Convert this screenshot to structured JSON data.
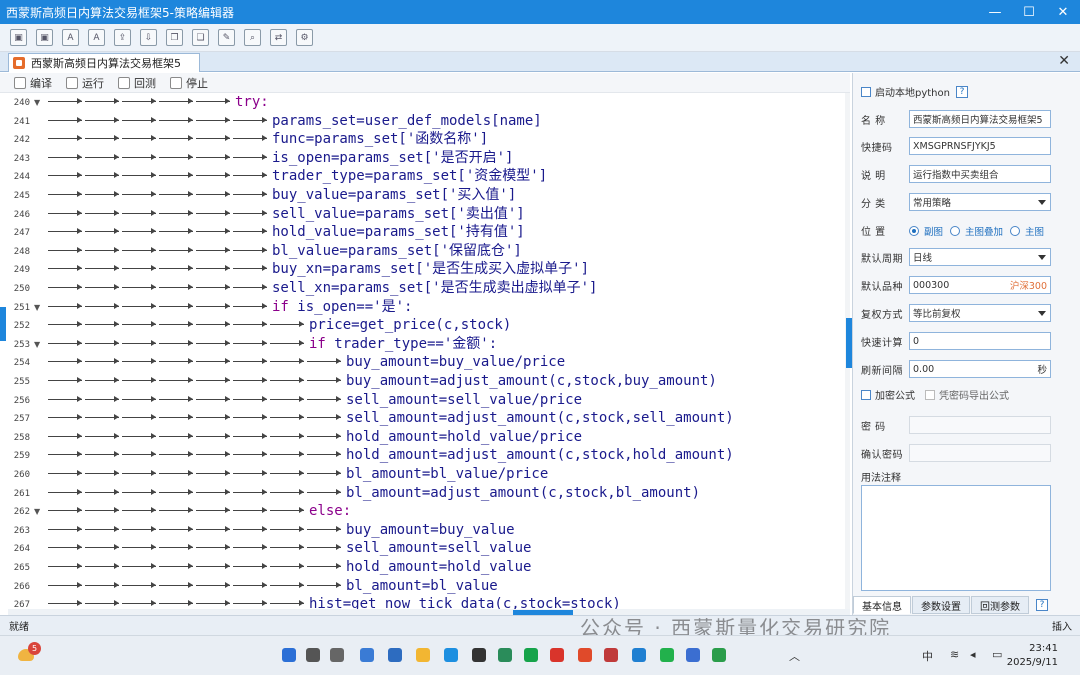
{
  "window": {
    "title": "西蒙斯高频日内算法交易框架5-策略编辑器",
    "min_label": "—",
    "max_label": "☐",
    "close_label": "✕"
  },
  "toolbar_icons": [
    "save-icon",
    "save-as-icon",
    "font-decrease-icon",
    "font-increase-icon",
    "export-icon",
    "import-icon",
    "copy-icon",
    "paste-icon",
    "edit-icon",
    "find-icon",
    "replace-icon",
    "settings-icon"
  ],
  "doc_tab": {
    "label": "西蒙斯高频日内算法交易框架5",
    "close": "✕"
  },
  "editor_toolbar": {
    "compile": "编译",
    "run": "运行",
    "backtest": "回测",
    "stop": "停止"
  },
  "code_lines": [
    {
      "n": "240",
      "fold": "▼",
      "indent": 5,
      "text": "try:",
      "kw": true
    },
    {
      "n": "241",
      "fold": "",
      "indent": 6,
      "text": "params_set=user_def_models[name]"
    },
    {
      "n": "242",
      "fold": "",
      "indent": 6,
      "text": "func=params_set['函数名称']"
    },
    {
      "n": "243",
      "fold": "",
      "indent": 6,
      "text": "is_open=params_set['是否开启']"
    },
    {
      "n": "244",
      "fold": "",
      "indent": 6,
      "text": "trader_type=params_set['资金模型']"
    },
    {
      "n": "245",
      "fold": "",
      "indent": 6,
      "text": "buy_value=params_set['买入值']"
    },
    {
      "n": "246",
      "fold": "",
      "indent": 6,
      "text": "sell_value=params_set['卖出值']"
    },
    {
      "n": "247",
      "fold": "",
      "indent": 6,
      "text": "hold_value=params_set['持有值']"
    },
    {
      "n": "248",
      "fold": "",
      "indent": 6,
      "text": "bl_value=params_set['保留底仓']"
    },
    {
      "n": "249",
      "fold": "",
      "indent": 6,
      "text": "buy_xn=params_set['是否生成买入虚拟单子']"
    },
    {
      "n": "250",
      "fold": "",
      "indent": 6,
      "text": "sell_xn=params_set['是否生成卖出虚拟单子']"
    },
    {
      "n": "251",
      "fold": "▼",
      "indent": 6,
      "text": "if is_open=='是':",
      "kwprefix": "if"
    },
    {
      "n": "252",
      "fold": "",
      "indent": 7,
      "text": "price=get_price(c,stock)"
    },
    {
      "n": "253",
      "fold": "▼",
      "indent": 7,
      "text": "if trader_type=='金额':",
      "kwprefix": "if"
    },
    {
      "n": "254",
      "fold": "",
      "indent": 8,
      "text": "buy_amount=buy_value/price"
    },
    {
      "n": "255",
      "fold": "",
      "indent": 8,
      "text": "buy_amount=adjust_amount(c,stock,buy_amount)"
    },
    {
      "n": "256",
      "fold": "",
      "indent": 8,
      "text": "sell_amount=sell_value/price"
    },
    {
      "n": "257",
      "fold": "",
      "indent": 8,
      "text": "sell_amount=adjust_amount(c,stock,sell_amount)"
    },
    {
      "n": "258",
      "fold": "",
      "indent": 8,
      "text": "hold_amount=hold_value/price"
    },
    {
      "n": "259",
      "fold": "",
      "indent": 8,
      "text": "hold_amount=adjust_amount(c,stock,hold_amount)"
    },
    {
      "n": "260",
      "fold": "",
      "indent": 8,
      "text": "bl_amount=bl_value/price"
    },
    {
      "n": "261",
      "fold": "",
      "indent": 8,
      "text": "bl_amount=adjust_amount(c,stock,bl_amount)"
    },
    {
      "n": "262",
      "fold": "▼",
      "indent": 7,
      "text": "else:",
      "kw": true
    },
    {
      "n": "263",
      "fold": "",
      "indent": 8,
      "text": "buy_amount=buy_value"
    },
    {
      "n": "264",
      "fold": "",
      "indent": 8,
      "text": "sell_amount=sell_value"
    },
    {
      "n": "265",
      "fold": "",
      "indent": 8,
      "text": "hold_amount=hold_value"
    },
    {
      "n": "266",
      "fold": "",
      "indent": 8,
      "text": "bl_amount=bl_value"
    },
    {
      "n": "267",
      "fold": "",
      "indent": 7,
      "text": "hist=get_now_tick_data(c,stock=stock)"
    }
  ],
  "panel": {
    "enable_python": "启动本地python",
    "help": "?",
    "name_label": "名    称",
    "name_value": "西蒙斯高频日内算法交易框架5",
    "shortcut_label": "快捷码",
    "shortcut_value": "XMSGPRNSFJYKJ5",
    "desc_label": "说    明",
    "desc_value": "运行指数中买卖组合",
    "category_label": "分    类",
    "category_value": "常用策略",
    "position_label": "位    置",
    "position_options": [
      "副图",
      "主图叠加",
      "主图"
    ],
    "period_label": "默认周期",
    "period_value": "日线",
    "symbol_label": "默认品种",
    "symbol_code": "000300",
    "symbol_name": "沪深300",
    "adjust_label": "复权方式",
    "adjust_value": "等比前复权",
    "fastcalc_label": "快速计算",
    "fastcalc_value": "0",
    "refresh_label": "刷新间隔",
    "refresh_value": "0.00",
    "refresh_unit": "秒",
    "encrypt_label": "加密公式",
    "export_pwd_label": "凭密码导出公式",
    "password_label": "密    码",
    "confirm_label": "确认密码",
    "notes_label": "用法注释",
    "tabs": [
      "基本信息",
      "参数设置",
      "回测参数"
    ]
  },
  "status": {
    "left": "就绪",
    "right": "插入"
  },
  "watermark": "公众号 · 西蒙斯量化交易研究院",
  "taskbar": {
    "weather_badge": "5",
    "ime": "中",
    "time": "23:41",
    "date": "2025/9/11"
  }
}
